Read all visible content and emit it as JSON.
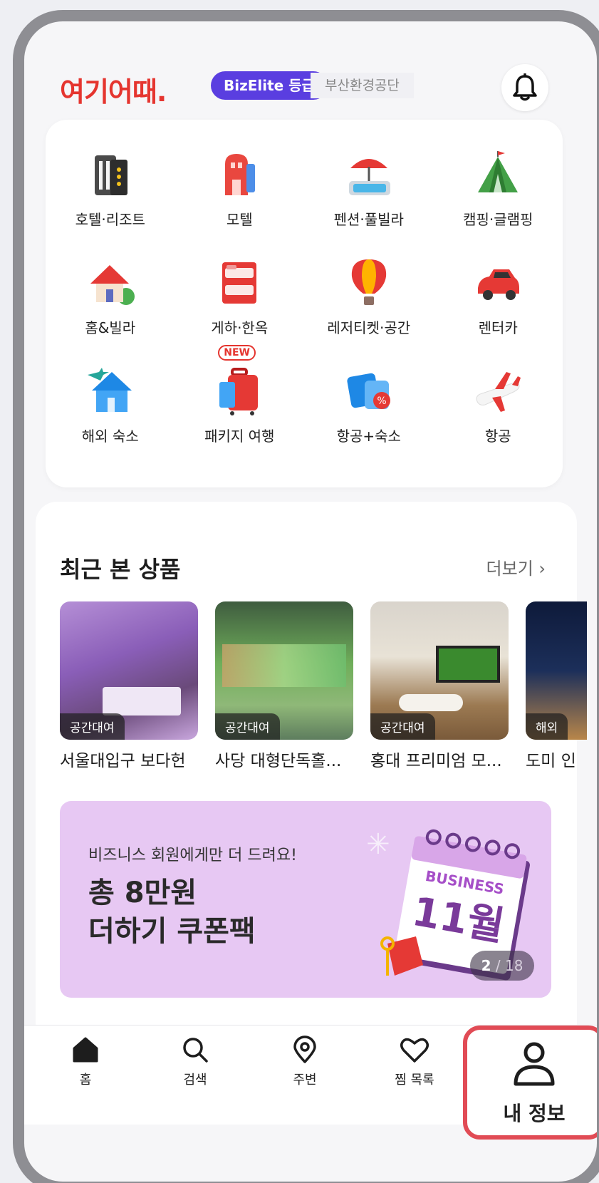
{
  "header": {
    "logo": "여기어때.",
    "grade_badge": "BizElite 등급",
    "company": "부산환경공단",
    "bell_icon": "bell-icon"
  },
  "categories": [
    {
      "label": "호텔·리조트",
      "icon": "hotel-icon"
    },
    {
      "label": "모텔",
      "icon": "motel-icon"
    },
    {
      "label": "펜션·풀빌라",
      "icon": "pool-villa-icon"
    },
    {
      "label": "캠핑·글램핑",
      "icon": "tent-icon"
    },
    {
      "label": "홈&빌라",
      "icon": "house-icon"
    },
    {
      "label": "게하·한옥",
      "icon": "bunkbed-icon"
    },
    {
      "label": "레저티켓·공간",
      "icon": "balloon-icon"
    },
    {
      "label": "렌터카",
      "icon": "car-icon"
    },
    {
      "label": "해외 숙소",
      "icon": "overseas-stay-icon"
    },
    {
      "label": "패키지 여행",
      "icon": "luggage-icon",
      "tag": "NEW"
    },
    {
      "label": "항공+숙소",
      "icon": "ticket-icon"
    },
    {
      "label": "항공",
      "icon": "airplane-icon"
    }
  ],
  "recent": {
    "title": "최근 본 상품",
    "more": "더보기 ›",
    "items": [
      {
        "badge": "공간대여",
        "name": "서울대입구 보다헌"
      },
      {
        "badge": "공간대여",
        "name": "사당 대형단독홀..."
      },
      {
        "badge": "공간대여",
        "name": "홍대 프리미엄 모..."
      },
      {
        "badge": "해외",
        "name": "도미 인"
      }
    ]
  },
  "banner": {
    "subtitle": "비즈니스 회원에게만 더 드려요!",
    "title": "총 8만원\n더하기 쿠폰팩",
    "calendar_label": "BUSINESS",
    "calendar_month": "11월",
    "page_current": "2",
    "page_total": "18"
  },
  "nav": {
    "items": [
      {
        "label": "홈",
        "icon": "home-icon"
      },
      {
        "label": "검색",
        "icon": "search-icon"
      },
      {
        "label": "주변",
        "icon": "location-pin-icon"
      },
      {
        "label": "찜 목록",
        "icon": "heart-icon"
      },
      {
        "label": "내 정보",
        "icon": "person-icon"
      }
    ]
  },
  "colors": {
    "brand_red": "#e5352f",
    "biz_purple": "#5a3ee0",
    "banner_bg": "#e7c8f3",
    "highlight": "#e14b55"
  }
}
